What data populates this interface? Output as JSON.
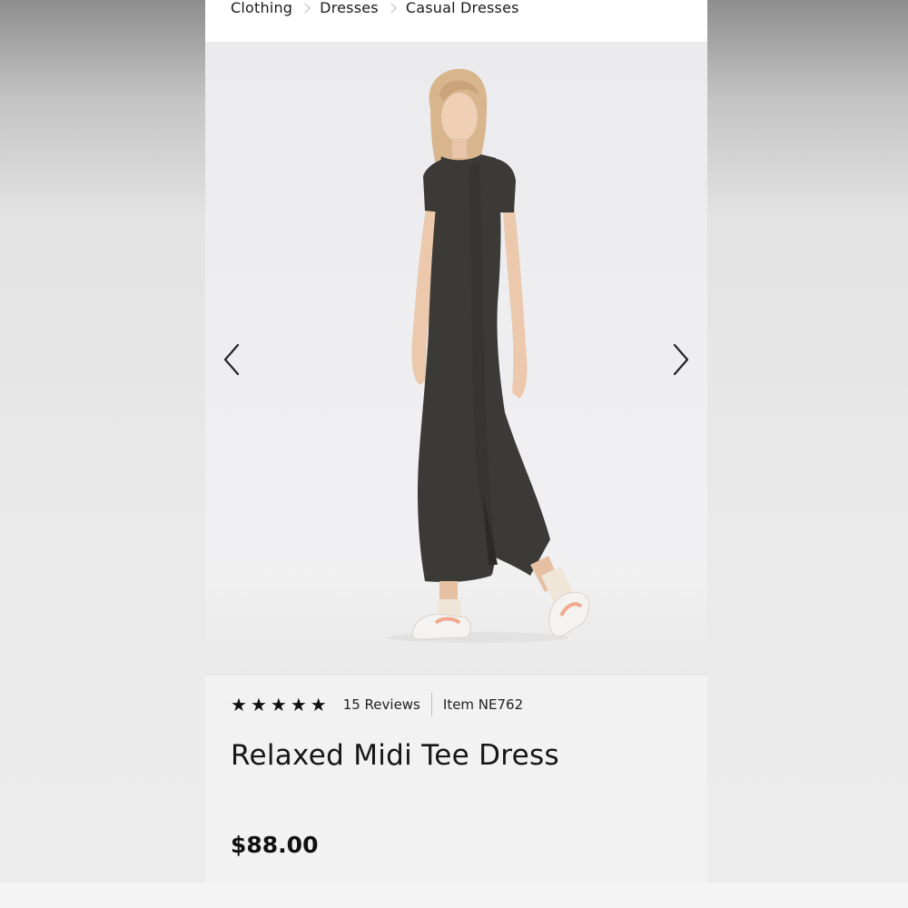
{
  "breadcrumb": {
    "items": [
      "Clothing",
      "Dresses",
      "Casual Dresses"
    ]
  },
  "gallery": {
    "prev_icon": "chevron-left-icon",
    "next_icon": "chevron-right-icon"
  },
  "product": {
    "rating": 5,
    "max_rating": 5,
    "reviews_label": "15 Reviews",
    "item_code": "Item NE762",
    "title": "Relaxed Midi Tee Dress",
    "price": "$88.00"
  },
  "colors": {
    "dress": "#3b3a37",
    "background": "#f2f2f2",
    "text": "#161616"
  }
}
